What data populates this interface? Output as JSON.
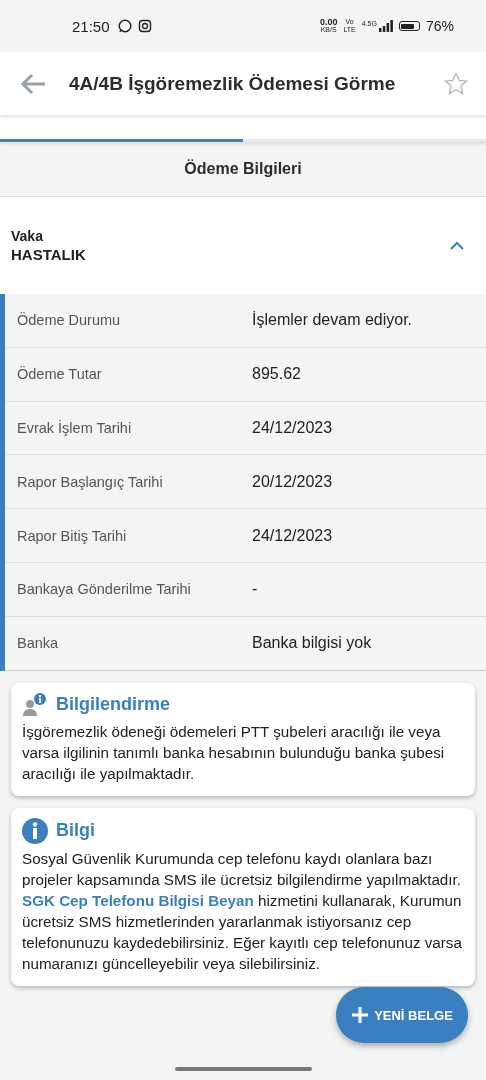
{
  "status_bar": {
    "time": "21:50",
    "speed": "0.00",
    "speed_unit": "KB/S",
    "volte_top": "Vo",
    "volte_bottom": "LTE",
    "network": "4.5G",
    "battery": "76%"
  },
  "app_bar": {
    "title": "4A/4B İşgöremezlik Ödemesi Görme",
    "favorite": false
  },
  "tabs": [
    {
      "selected": true
    },
    {
      "selected": false
    }
  ],
  "section_title": "Ödeme Bilgileri",
  "case": {
    "label": "Vaka",
    "value": "HASTALIK",
    "expanded": true
  },
  "details": [
    {
      "label": "Ödeme Durumu",
      "value": "İşlemler devam ediyor."
    },
    {
      "label": "Ödeme Tutar",
      "value": "895.62"
    },
    {
      "label": "Evrak İşlem Tarihi",
      "value": "24/12/2023"
    },
    {
      "label": "Rapor Başlangıç Tarihi",
      "value": "20/12/2023"
    },
    {
      "label": "Rapor Bitiş Tarihi",
      "value": "24/12/2023"
    },
    {
      "label": "Bankaya Gönderilme Tarihi",
      "value": "-"
    },
    {
      "label": "Banka",
      "value": "Banka bilgisi yok"
    }
  ],
  "cards": [
    {
      "kind": "notice",
      "title": "Bilgilendirme",
      "body": [
        {
          "kind": "text",
          "text": "İşgöremezlik ödeneği ödemeleri PTT şubeleri aracılığı ile veya varsa ilgilinin tanımlı banka hesabının bulunduğu banka şubesi aracılığı ile yapılmaktadır."
        }
      ]
    },
    {
      "kind": "info",
      "title": "Bilgi",
      "body": [
        {
          "kind": "text",
          "text": "Sosyal Güvenlik Kurumunda cep telefonu kaydı olanlara bazı projeler kapsamında SMS ile ücretsiz bilgilendirme yapılmaktadır. "
        },
        {
          "kind": "link",
          "text": "SGK Cep Telefonu Bilgisi Beyan"
        },
        {
          "kind": "text",
          "text": " hizmetini kullanarak, Kurumun ücretsiz SMS hizmetlerinden yararlanmak istiyorsanız cep telefonunuzu kaydedebilirsiniz. Eğer kayıtlı cep telefonunuz varsa numaranızı güncelleyebilir veya silebilirsiniz."
        }
      ]
    }
  ],
  "fab": {
    "label": "YENİ BELGE"
  }
}
